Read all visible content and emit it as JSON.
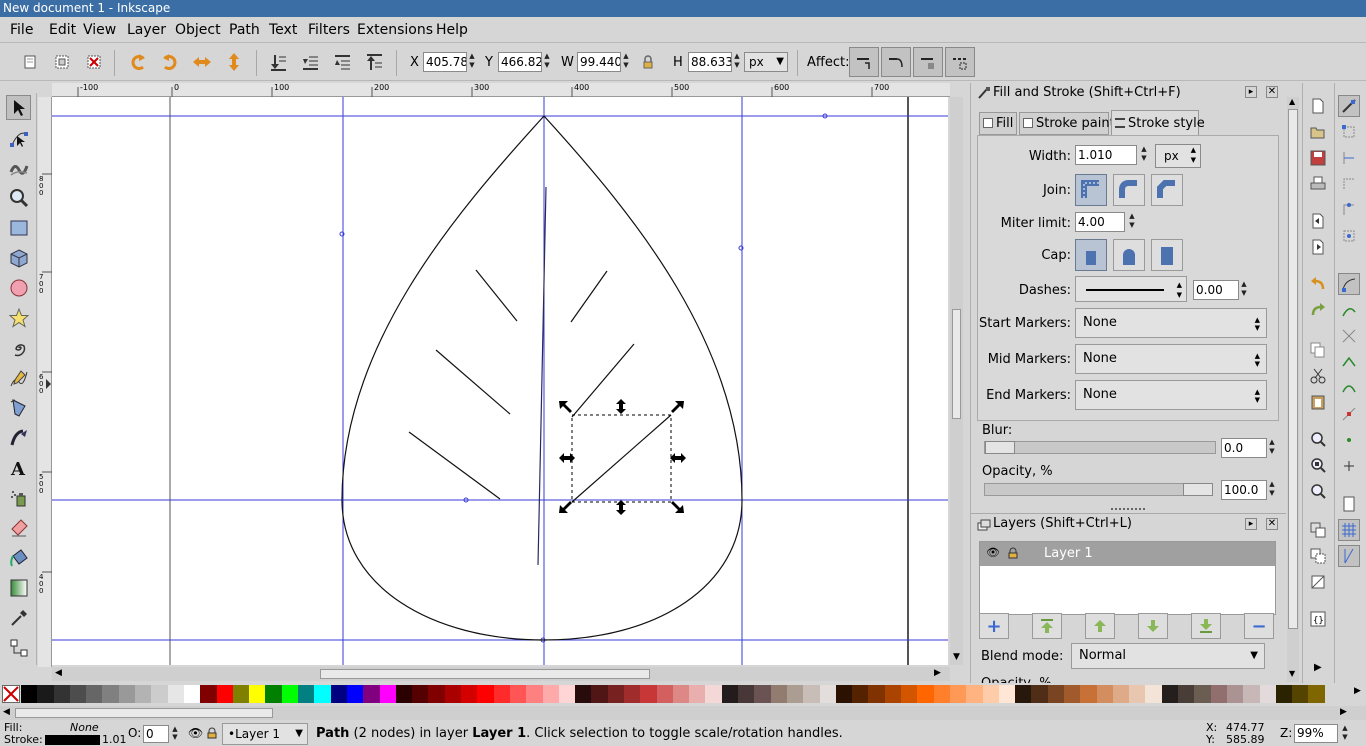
{
  "window": {
    "title": "New document 1 - Inkscape"
  },
  "menu": [
    "File",
    "Edit",
    "View",
    "Layer",
    "Object",
    "Path",
    "Text",
    "Filters",
    "Extensions",
    "Help"
  ],
  "toolbar": {
    "x_label": "X",
    "x_value": "405.788",
    "y_label": "Y",
    "y_value": "466.821",
    "w_label": "W",
    "w_value": "99.440",
    "h_label": "H",
    "h_value": "88.633",
    "unit": "px",
    "affect_label": "Affect:"
  },
  "ruler": {
    "h_ticks": [
      "-100",
      "0",
      "100",
      "200",
      "300",
      "400",
      "500",
      "600",
      "700"
    ],
    "v_ticks": [
      "800",
      "700",
      "600",
      "500",
      "400"
    ]
  },
  "fill_stroke": {
    "title": "Fill and Stroke (Shift+Ctrl+F)",
    "tabs": [
      "Fill",
      "Stroke paint",
      "Stroke style"
    ],
    "width_label": "Width:",
    "width_value": "1.010",
    "width_unit": "px",
    "join_label": "Join:",
    "miter_label": "Miter limit:",
    "miter_value": "4.00",
    "cap_label": "Cap:",
    "dashes_label": "Dashes:",
    "dashes_value": "0.00",
    "start_markers_label": "Start Markers:",
    "start_markers_value": "None",
    "mid_markers_label": "Mid Markers:",
    "mid_markers_value": "None",
    "end_markers_label": "End Markers:",
    "end_markers_value": "None",
    "blur_label": "Blur:",
    "blur_value": "0.0",
    "opacity_label": "Opacity, %",
    "opacity_value": "100.0"
  },
  "layers": {
    "title": "Layers (Shift+Ctrl+L)",
    "layer_name": "Layer 1",
    "blend_label": "Blend mode:",
    "blend_value": "Normal",
    "opacity_partial": "Opacity, %"
  },
  "palette": [
    "#000000",
    "#1a1a1a",
    "#333333",
    "#4d4d4d",
    "#666666",
    "#808080",
    "#999999",
    "#b3b3b3",
    "#cccccc",
    "#e6e6e6",
    "#ffffff",
    "#800000",
    "#ff0000",
    "#808000",
    "#ffff00",
    "#008000",
    "#00ff00",
    "#008080",
    "#00ffff",
    "#000080",
    "#0000ff",
    "#800080",
    "#ff00ff",
    "#2b0000",
    "#550000",
    "#800000",
    "#aa0000",
    "#d40000",
    "#ff0000",
    "#ff2a2a",
    "#ff5555",
    "#ff8080",
    "#ffaaaa",
    "#ffd5d5",
    "#280b0b",
    "#501616",
    "#782121",
    "#a02c2c",
    "#c83737",
    "#d35f5f",
    "#de8787",
    "#e9afaf",
    "#f4d7d7",
    "#241c1c",
    "#483737",
    "#6c5353",
    "#917c6f",
    "#ac9d93",
    "#c8beb7",
    "#e3dedb",
    "#2b1100",
    "#552200",
    "#803300",
    "#aa4400",
    "#d45500",
    "#ff6600",
    "#ff7f2a",
    "#ff9955",
    "#ffb380",
    "#ffccaa",
    "#ffe6d5",
    "#28170b",
    "#502d16",
    "#784421",
    "#a05a2c",
    "#c87137",
    "#d38d5f",
    "#deaa87",
    "#e9c6af",
    "#f4e3d7",
    "#241f1c",
    "#483e37",
    "#6c5d53",
    "#916f6f",
    "#ac9393",
    "#c8b7b7",
    "#e3dbdb",
    "#2b2200",
    "#554400",
    "#806600"
  ],
  "status": {
    "fill_label": "Fill:",
    "fill_value": "None",
    "stroke_label": "Stroke:",
    "stroke_width": "1.01",
    "opacity_label": "O:",
    "opacity_value": "0",
    "layer": "•Layer 1",
    "message_bold": "Path",
    "message_rest": " (2 nodes) in layer ",
    "message_layer": "Layer 1",
    "message_tail": ". Click selection to toggle scale/rotation handles.",
    "cursor_x_label": "X:",
    "cursor_x": "474.77",
    "cursor_y_label": "Y:",
    "cursor_y": "585.89",
    "zoom_label": "Z:",
    "zoom": "99%"
  },
  "colors": {
    "guide": "#3a3ad8",
    "selection": "#000000",
    "active_tool": "#c0c0c0"
  }
}
